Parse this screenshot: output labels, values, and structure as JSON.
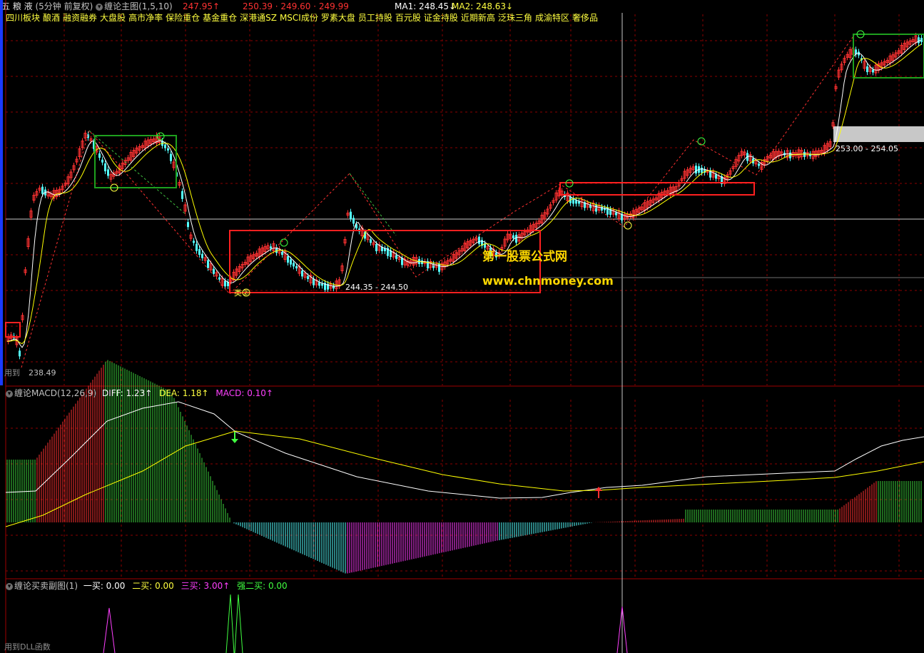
{
  "main_header": {
    "stock_name": "五 粮 液",
    "period": "(5分钟 前复权)",
    "indicator": "缠论主图(1,5,10)",
    "price_up": "247.95↑",
    "price_values": "250.39 · 249.60 · 249.99",
    "ma1": "MA1: 248.45↓",
    "ma2": "MA2: 248.63↓"
  },
  "tags": [
    "四川板块",
    "酿酒",
    "融资融券",
    "大盘股",
    "高市净率",
    "保险重仓",
    "基金重仓",
    "深港通SZ",
    "MSCI成份",
    "罗素大盘",
    "员工持股",
    "百元股",
    "证金持股",
    "近期新高",
    "泛珠三角",
    "成渝特区",
    "奢侈品"
  ],
  "price_labels": {
    "range_1": "244.35 - 244.50",
    "range_2": "253.00 - 254.05",
    "low_value": "238.49",
    "bottom_note": "用到",
    "class_label": "类②"
  },
  "watermark": {
    "line1": "第一股票公式网",
    "line2": "www.chnmoney.com"
  },
  "macd_header": {
    "name": "缠论MACD(12,26,9)",
    "diff": "DIFF: 1.23↑",
    "dea": "DEA: 1.18↑",
    "macd": "MACD: 0.10↑"
  },
  "sub_header": {
    "name": "缠论买卖副图(1)",
    "buy1": "一买: 0.00",
    "buy2": "二买: 0.00",
    "buy3": "三买: 3.00↑",
    "strong": "强二买: 0.00"
  },
  "bottom_note": "用到DLL函数",
  "colors": {
    "up": "#ff3232",
    "down": "#54ffff",
    "ma_white": "#ffffff",
    "ma_yellow": "#ffff00",
    "box_red": "#ff2020",
    "box_green": "#1ea01e",
    "grid": "#8b0000",
    "macd_pos": "#ff3232",
    "macd_green": "#3cd23c",
    "macd_blue": "#54ffff",
    "macd_magenta": "#ff3cff"
  }
}
